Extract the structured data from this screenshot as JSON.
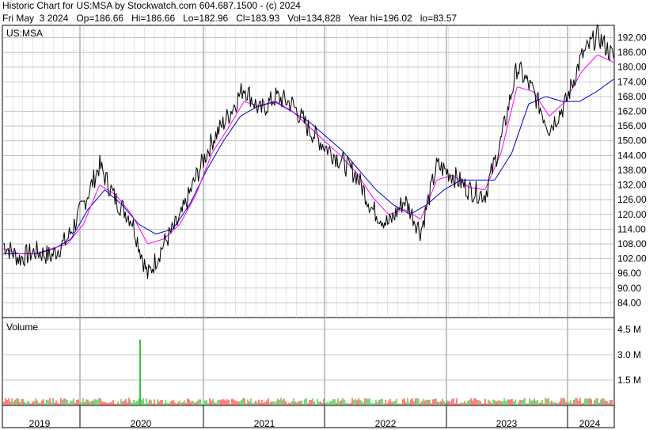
{
  "header": {
    "title": "Historic Chart for US:MSA by Stockwatch.com 604.687.1500 - (c) 2024",
    "quote": "Fri May  3 2024   Op=186.66   Hi=186.66   Lo=182.96   Cl=183.93   Vol=134,828   Year hi=196.02   lo=83.57"
  },
  "colors": {
    "price": "#000000",
    "ma_short": "#ff00ff",
    "ma_long": "#0000cc",
    "volume_up": "#00aa00",
    "volume_down": "#ff0000",
    "grid": "#b0b0b0"
  },
  "chart_data": [
    {
      "type": "line",
      "title": "US:MSA",
      "ylim": [
        78,
        197
      ],
      "y_ticks": [
        192,
        186,
        180,
        174,
        168,
        162,
        156,
        150,
        144,
        138,
        132,
        126,
        120,
        114,
        108,
        102,
        96,
        90,
        84
      ],
      "y_tick_labels": [
        "192.00",
        "186.00",
        "180.00",
        "174.00",
        "168.00",
        "162.00",
        "156.00",
        "150.00",
        "144.00",
        "138.00",
        "132.00",
        "126.00",
        "120.00",
        "114.00",
        "108.00",
        "102.00",
        "96.00",
        "90.00",
        "84.00"
      ],
      "x_labels": [
        "2019",
        "2020",
        "2021",
        "2022",
        "2023",
        "2024"
      ],
      "x": [
        "2018-11",
        "2019-01",
        "2019-03",
        "2019-05",
        "2019-07",
        "2019-09",
        "2019-11",
        "2020-01",
        "2020-02",
        "2020-03",
        "2020-04",
        "2020-06",
        "2020-08",
        "2020-10",
        "2020-12",
        "2021-02",
        "2021-04",
        "2021-06",
        "2021-08",
        "2021-10",
        "2021-12",
        "2022-02",
        "2022-04",
        "2022-06",
        "2022-08",
        "2022-10",
        "2022-12",
        "2023-02",
        "2023-04",
        "2023-06",
        "2023-08",
        "2023-10",
        "2023-12",
        "2024-02",
        "2024-04",
        "2024-05"
      ],
      "series": [
        {
          "name": "",
          "values": [
            108,
            102,
            105,
            103,
            110,
            124,
            140,
            126,
            118,
            95,
            108,
            118,
            135,
            150,
            160,
            172,
            162,
            168,
            165,
            155,
            148,
            142,
            136,
            122,
            116,
            126,
            113,
            140,
            136,
            130,
            128,
            150,
            180,
            170,
            155,
            165,
            184,
            193,
            184
          ]
        },
        {
          "name": "",
          "values": [
            106,
            104,
            104,
            106,
            108,
            116,
            132,
            128,
            120,
            108,
            110,
            116,
            128,
            145,
            155,
            166,
            164,
            166,
            162,
            156,
            150,
            144,
            137,
            127,
            120,
            122,
            118,
            134,
            136,
            131,
            130,
            145,
            172,
            170,
            160,
            166,
            178,
            185,
            182
          ]
        },
        {
          "name": "",
          "values": [
            104,
            104,
            104,
            106,
            110,
            122,
            130,
            124,
            116,
            112,
            114,
            124,
            138,
            150,
            160,
            164,
            166,
            162,
            158,
            152,
            146,
            138,
            130,
            124,
            120,
            124,
            130,
            134,
            134,
            134,
            145,
            165,
            168,
            166,
            166,
            170,
            175
          ]
        }
      ]
    },
    {
      "type": "bar",
      "title": "Volume",
      "y_tick_labels": [
        "4.5 M",
        "3.0 M",
        "1.5 M"
      ],
      "ylim": [
        0,
        5200000
      ],
      "spike": {
        "x": "2020-03",
        "value": 3900000
      },
      "typical_daily_volume": 250000
    }
  ]
}
